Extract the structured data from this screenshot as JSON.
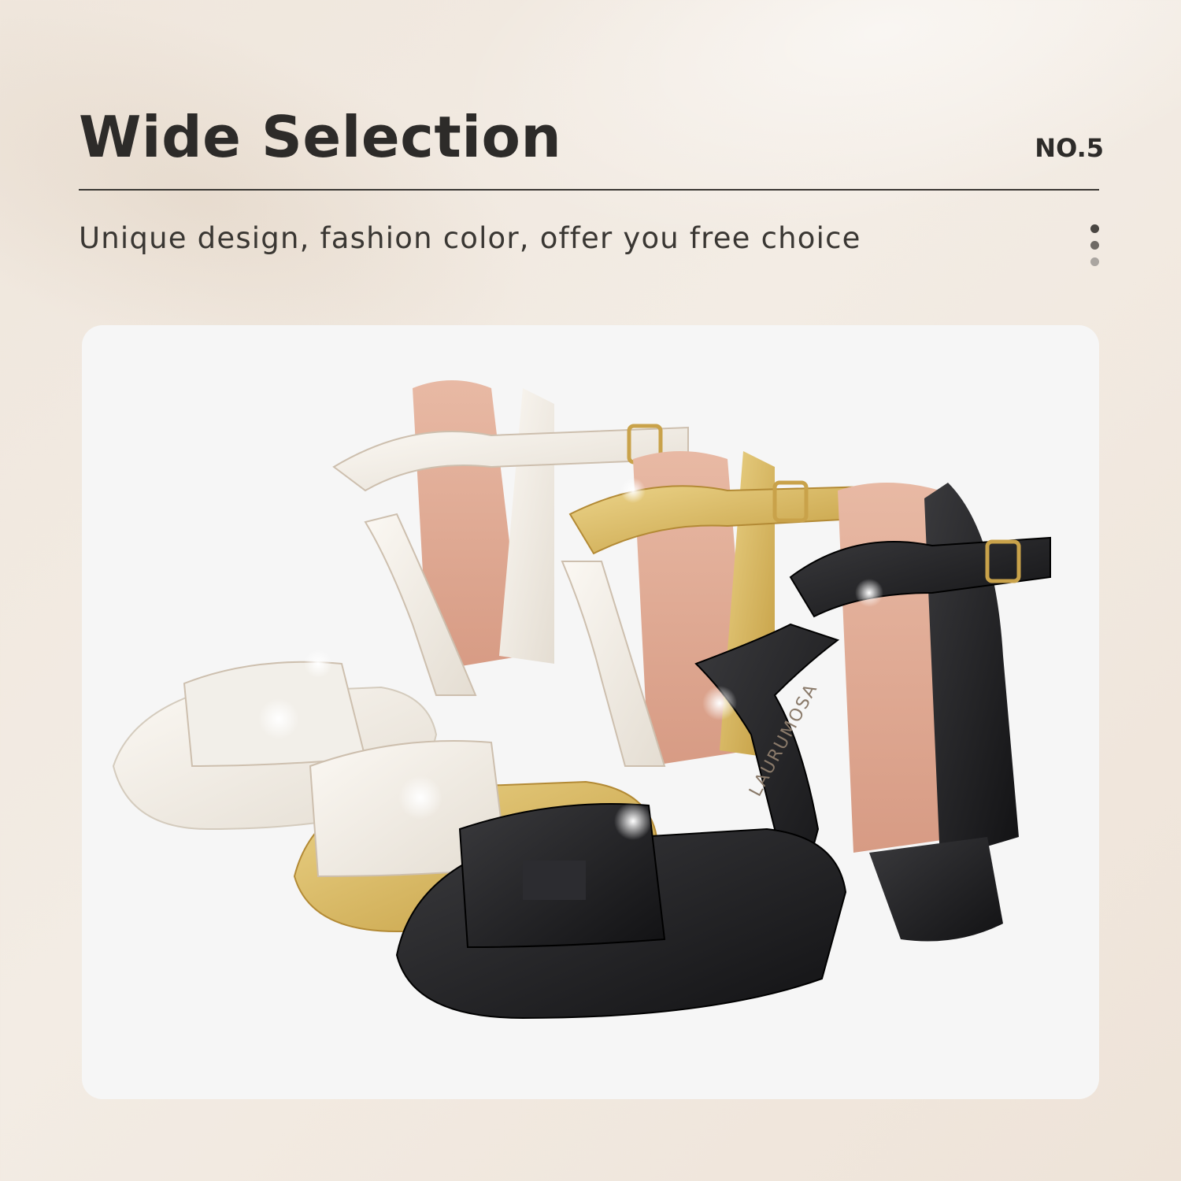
{
  "header": {
    "title": "Wide Selection",
    "page_number": "NO.5",
    "subtitle": "Unique design, fashion color, offer you free choice"
  },
  "pagination": {
    "total_dots": 3,
    "active_index": 0
  },
  "product_image": {
    "brand_insole_text": "LAURUMOSA",
    "colors": [
      "#efe9e0",
      "#d8b75c",
      "#1e1e20"
    ]
  }
}
